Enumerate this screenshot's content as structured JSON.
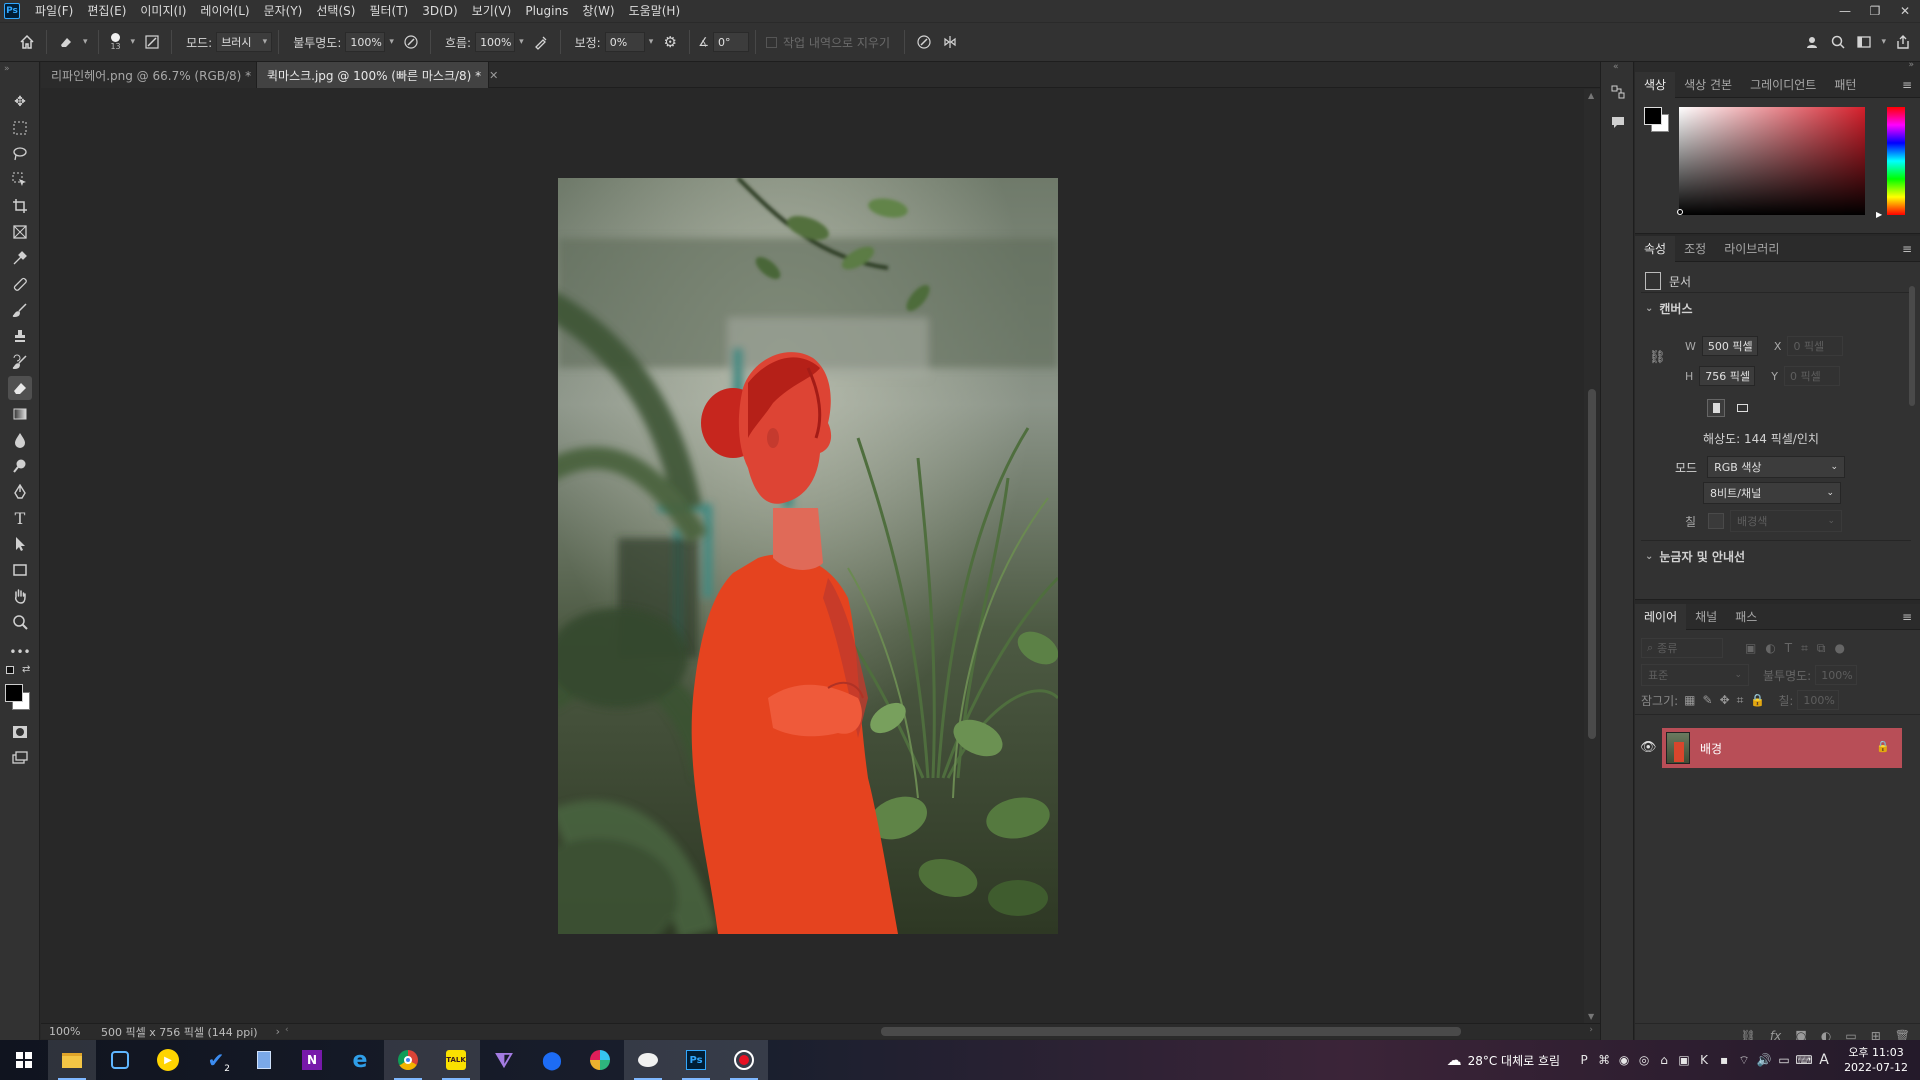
{
  "app": {
    "logo_text": "Ps",
    "menu": [
      "파일(F)",
      "편집(E)",
      "이미지(I)",
      "레이어(L)",
      "문자(Y)",
      "선택(S)",
      "필터(T)",
      "3D(D)",
      "보기(V)",
      "Plugins",
      "창(W)",
      "도움말(H)"
    ]
  },
  "options": {
    "brush_size": "13",
    "mode_label": "모드:",
    "mode_value": "브러시",
    "opacity_label": "불투명도:",
    "opacity_value": "100%",
    "flow_label": "흐름:",
    "flow_value": "100%",
    "smoothing_label": "보정:",
    "smoothing_value": "0%",
    "angle_value": "0°",
    "erase_history_label": "작업 내역으로 지우기"
  },
  "tabs": [
    {
      "label": "리파인헤어.png @ 66.7% (RGB/8) *"
    },
    {
      "label": "퀵마스크.jpg @ 100% (빠른 마스크/8) *"
    }
  ],
  "status": {
    "zoom": "100%",
    "doc_info": "500 픽셀 x 756 픽셀 (144 ppi)",
    "arrow": "›"
  },
  "color_panel": {
    "tabs": [
      "색상",
      "색상 견본",
      "그레이디언트",
      "패턴"
    ],
    "hue_color": "#d41f2b"
  },
  "properties_panel": {
    "tabs": [
      "속성",
      "조정",
      "라이브러리"
    ],
    "doc_label": "문서",
    "canvas_section": "캔버스",
    "w_label": "W",
    "w_value": "500 픽셀",
    "h_label": "H",
    "h_value": "756 픽셀",
    "x_label": "X",
    "x_placeholder": "0 픽셀",
    "y_label": "Y",
    "y_placeholder": "0 픽셀",
    "resolution": "해상도: 144 픽셀/인치",
    "mode_label": "모드",
    "mode_value": "RGB 색상",
    "bit_value": "8비트/채널",
    "fill_label": "칠",
    "fill_value": "배경색",
    "rulers_section": "눈금자 및 안내선"
  },
  "layers_panel": {
    "tabs": [
      "레이어",
      "채널",
      "패스"
    ],
    "filter_placeholder": "종류",
    "blend_value": "표준",
    "opacity_label": "불투명도:",
    "opacity_value": "100%",
    "lock_label": "잠그기:",
    "fill_label": "칠:",
    "fill_value": "100%",
    "layers": [
      {
        "name": "배경",
        "visible": true,
        "locked": true
      }
    ],
    "footer_icons": [
      "link-icon",
      "fx-icon",
      "mask-icon",
      "adjustment-icon",
      "group-icon",
      "new-layer-icon",
      "trash-icon"
    ]
  },
  "taskbar": {
    "weather": "28°C 대체로 흐림",
    "time": "오후 11:03",
    "date": "2022-07-12",
    "ime": "A",
    "todo_badge": "2"
  }
}
